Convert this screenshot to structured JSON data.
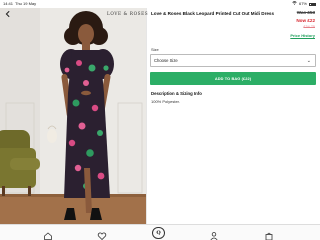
{
  "status_bar": {
    "time": "14:41",
    "date": "Thu 19 May",
    "battery": "67%"
  },
  "brand": {
    "logo_text": "LOVE & ROSES"
  },
  "product": {
    "title": "Love & Roses Black Leopard Printed Cut Out Midi Dress",
    "was_price": "Was £53",
    "now_price": "Now £22",
    "old_price": "£34.75",
    "price_history_label": "Price History"
  },
  "size": {
    "label": "Size",
    "select_value": "Choose Size"
  },
  "add_to_bag": {
    "label": "ADD TO BAG (£22)"
  },
  "description": {
    "heading": "Description & Sizing Info",
    "body": "100% Polyester."
  },
  "tabbar": {
    "brand_icon_text": "Q"
  },
  "icons": {
    "back": "chevron-left-icon",
    "home": "home-icon",
    "wishlist": "heart-icon",
    "account": "person-icon",
    "bag": "bag-icon"
  },
  "colors": {
    "accent": "#2cae66",
    "sale": "#d7262e",
    "link": "#1f9e5b"
  }
}
